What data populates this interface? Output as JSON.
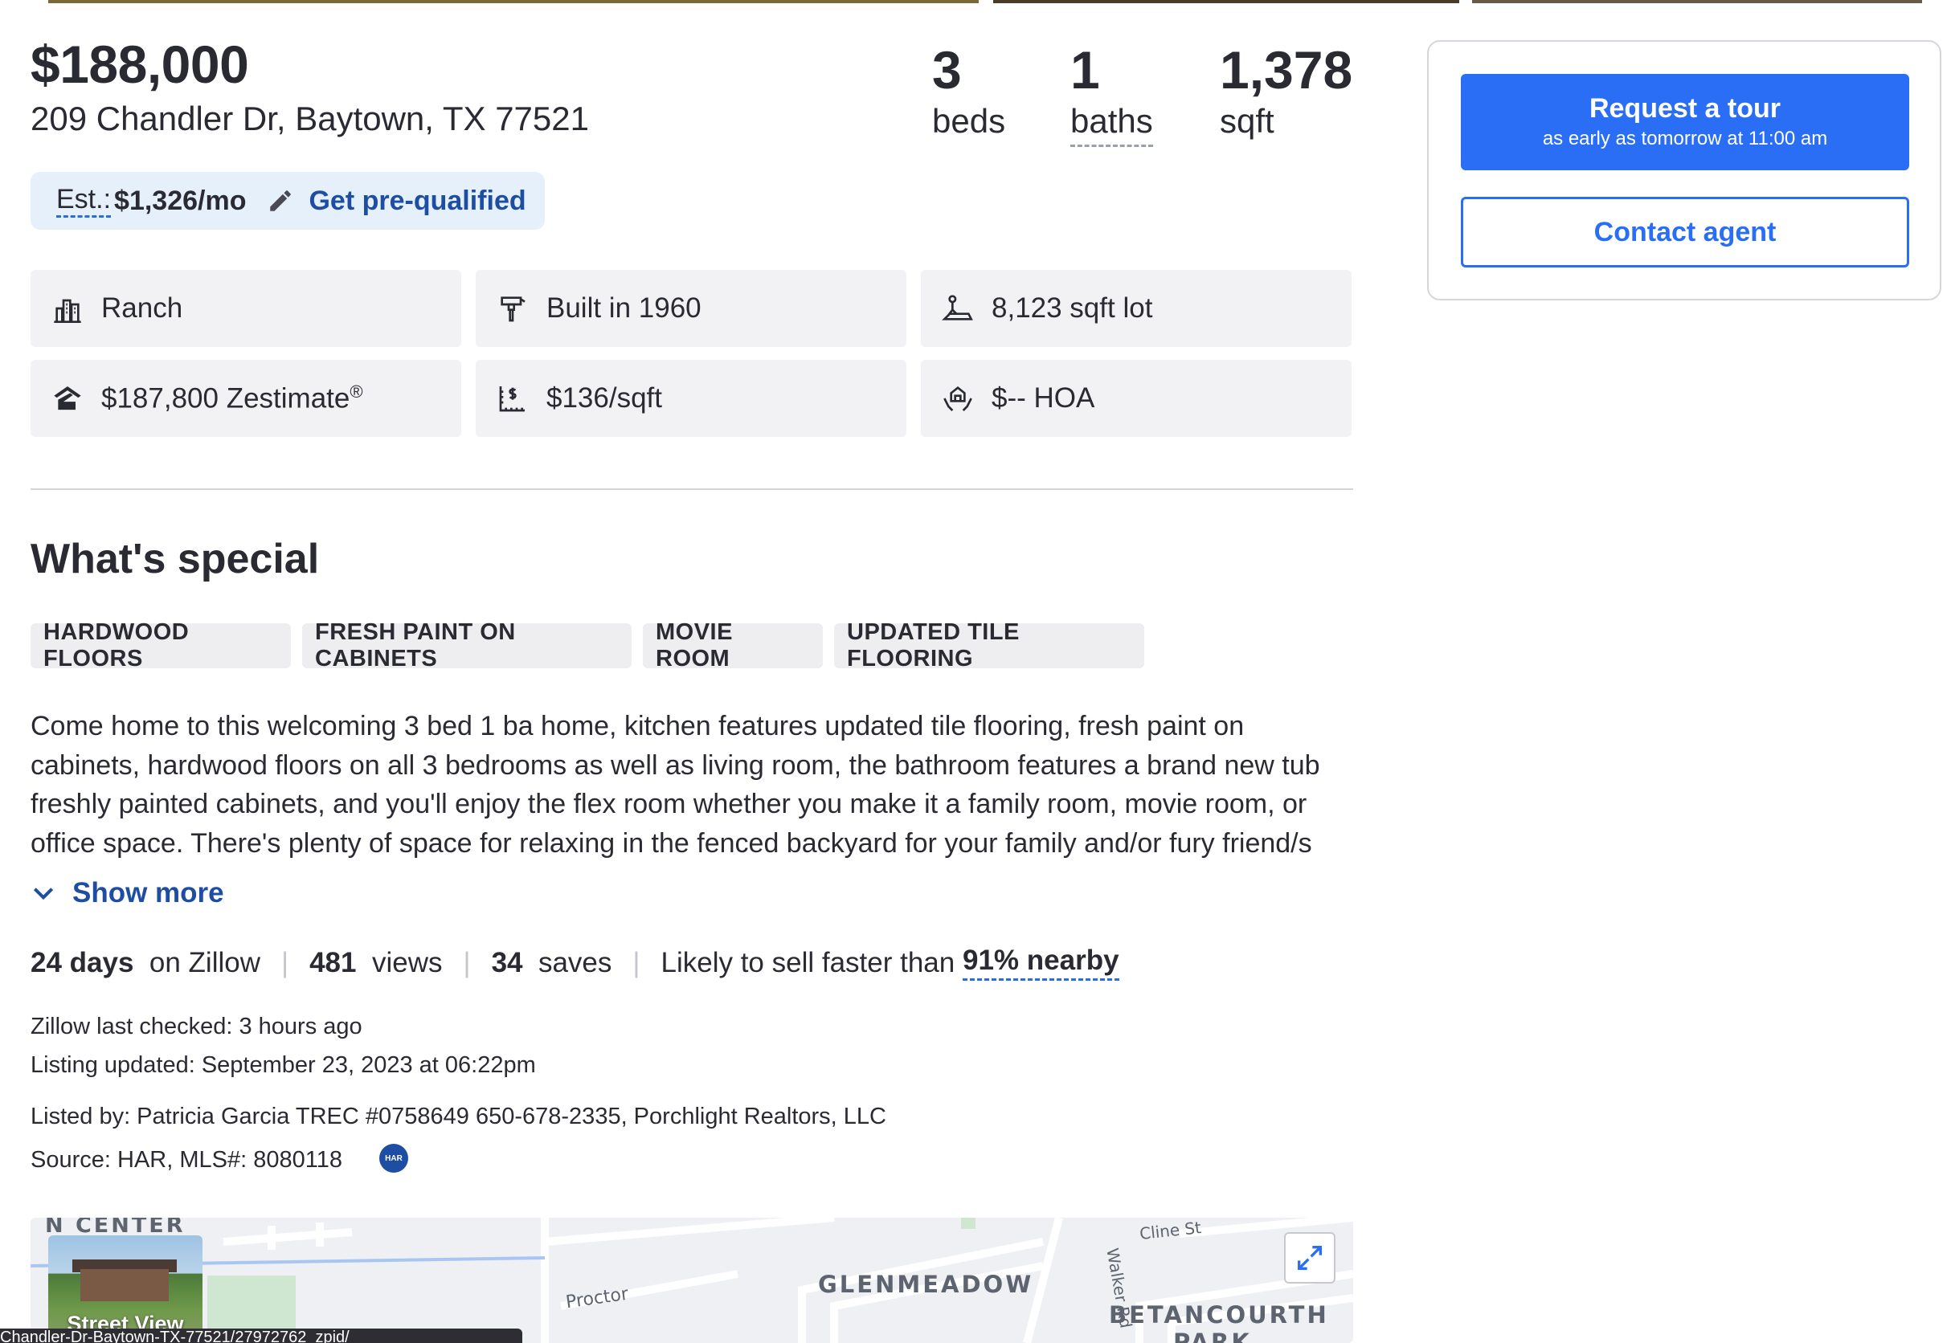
{
  "listing": {
    "price": "$188,000",
    "address": "209 Chandler Dr, Baytown, TX 77521",
    "stats": [
      {
        "value": "3",
        "label": "beds"
      },
      {
        "value": "1",
        "label": "baths"
      },
      {
        "value": "1,378",
        "label": "sqft"
      }
    ]
  },
  "estimate": {
    "label": "Est.:",
    "value": "$1,326/mo",
    "action": "Get pre-qualified"
  },
  "facts": [
    {
      "icon": "building-icon",
      "text": "Ranch"
    },
    {
      "icon": "hammer-icon",
      "text": "Built in 1960"
    },
    {
      "icon": "lot-icon",
      "text": "8,123 sqft lot"
    },
    {
      "icon": "zillow-house-icon",
      "text": "$187,800 Zestimate",
      "sup": "®"
    },
    {
      "icon": "price-per-sqft-icon",
      "text": "$136/sqft"
    },
    {
      "icon": "hoa-hands-icon",
      "text": "$-- HOA"
    }
  ],
  "special": {
    "title": "What's special",
    "tags": [
      "HARDWOOD FLOORS",
      "FRESH PAINT ON CABINETS",
      "MOVIE ROOM",
      "UPDATED TILE FLOORING"
    ],
    "description_lines": [
      "Come home to this welcoming 3 bed 1 ba home, kitchen features updated tile flooring, fresh paint on",
      "cabinets, hardwood floors on all 3 bedrooms as well as living room,  the bathroom features a brand new tub",
      "freshly painted cabinets, and you'll enjoy the flex room whether you make it a family room, movie room, or",
      "office space. There's plenty of space for relaxing  in the fenced backyard for your family and/or fury friend/s"
    ],
    "show_more": "Show more"
  },
  "metrics": {
    "days_value": "24 days",
    "days_suffix": "on Zillow",
    "views_value": "481",
    "views_suffix": "views",
    "saves_value": "34",
    "saves_suffix": "saves",
    "sell_prefix": "Likely to sell faster than",
    "sell_value": "91% nearby",
    "separator": "|"
  },
  "meta": {
    "last_checked": "Zillow last checked: 3 hours ago",
    "updated": "Listing updated: September 23, 2023 at 06:22pm",
    "listed_by": "Listed by: Patricia Garcia TREC #0758649 650-678-2335, Porchlight Realtors, LLC",
    "source": "Source: HAR,  MLS#: 8080118",
    "har_badge": "HAR"
  },
  "map": {
    "labels": [
      "N CENTER",
      "Proctor",
      "GLENMEADOW",
      "Walker Rd",
      "Cline St",
      "BETANCOURTH",
      "PARK"
    ],
    "street_view": "Street View"
  },
  "status_bar": "Chandler-Dr-Baytown-TX-77521/27972762_zpid/",
  "sidebar": {
    "tour_title": "Request a tour",
    "tour_subtitle": "as early as tomorrow at 11:00 am",
    "contact": "Contact agent"
  },
  "colors": {
    "accent": "#2a6ef5",
    "link": "#1d4ea3",
    "pill_bg": "#e6f0fb",
    "fact_bg": "#f2f2f4"
  }
}
